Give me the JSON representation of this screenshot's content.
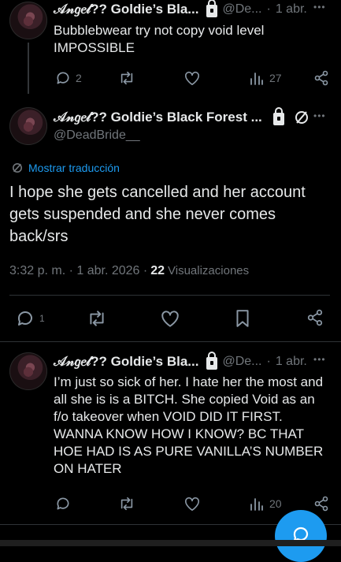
{
  "post1": {
    "name": "𝒜𝓃𝑔𝑒𝓁?? Goldie’s Bla...",
    "handle": "@De...",
    "sep": "·",
    "time": "1 abr.",
    "text": "Bubblebwear try not copy void level IMPOSSIBLE",
    "replies": "2",
    "views": "27"
  },
  "post2": {
    "name": "𝒜𝓃𝑔𝑒𝓁?? Goldie’s Black Forest ...",
    "handle": "@DeadBride__",
    "translate": "Mostrar traducción",
    "text": "I hope she gets cancelled and her account gets suspended and she never comes back/srs",
    "timestamp": "3:32 p. m. · 1 abr. 2026 ·",
    "views_count": "22",
    "views_label": "Visualizaciones",
    "replies": "1"
  },
  "post3": {
    "name": "𝒜𝓃𝑔𝑒𝓁?? Goldie’s Bla...",
    "handle": "@De...",
    "sep": "·",
    "time": "1 abr.",
    "text": "I’m just so sick of her. I hate her the most and all she is is a BITCH. She copied Void as an f/o takeover when VOID DID IT FIRST. WANNA KNOW HOW I KNOW? BC THAT HOE HAD IS AS PURE VANILLA’S NUMBER ON HATER",
    "views": "20"
  },
  "more_glyph": "•••",
  "colors": {
    "accent": "#1d9bf0",
    "muted": "#71767b",
    "text": "#e7e9ea",
    "bg": "#000000"
  }
}
